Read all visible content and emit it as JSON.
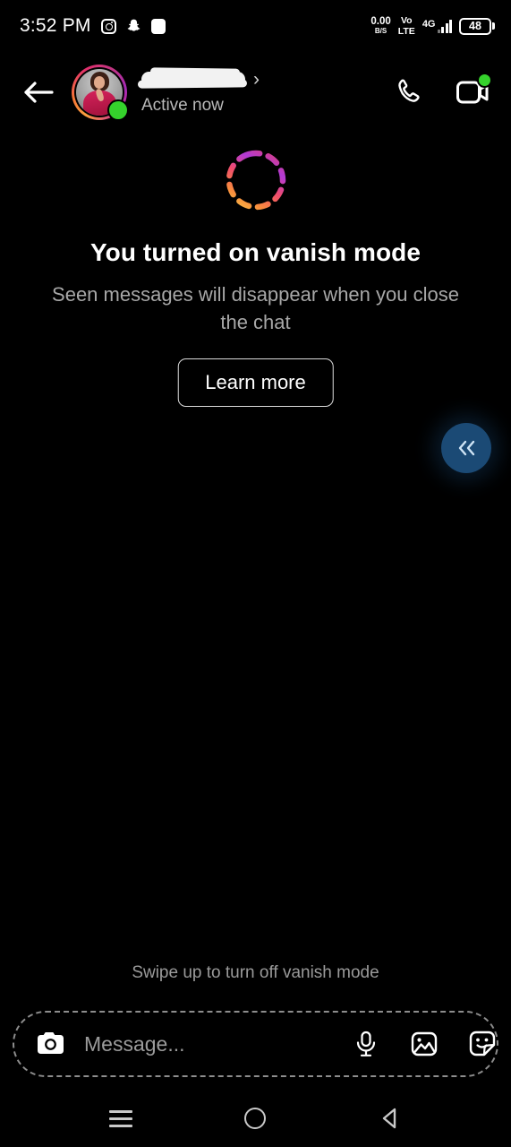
{
  "status_bar": {
    "time": "3:52 PM",
    "app_icons": [
      "instagram-icon",
      "snapchat-icon",
      "white-square-icon"
    ],
    "data_speed_value": "0.00",
    "data_speed_unit": "B/S",
    "volte_line1": "Vo",
    "volte_line2": "LTE",
    "network_type": "4G",
    "battery_percent": "48"
  },
  "header": {
    "back_icon": "arrow-left-icon",
    "username_redacted": "",
    "chevron": "›",
    "status": "Active now",
    "call_icon": "phone-icon",
    "video_icon": "video-camera-icon",
    "presence": "online"
  },
  "vanish": {
    "icon": "dashed-circle-icon",
    "title": "You turned on vanish mode",
    "subtitle": "Seen messages will disappear when you close the chat",
    "learn_more_label": "Learn more"
  },
  "floating_button": {
    "icon": "double-chevron-left-icon",
    "color": "#1b4a75"
  },
  "swipe_hint": "Swipe up to turn off vanish mode",
  "composer": {
    "camera_icon": "camera-icon",
    "placeholder": "Message...",
    "value": "",
    "mic_icon": "microphone-icon",
    "gallery_icon": "image-icon",
    "sticker_icon": "sticker-icon"
  },
  "nav_bar": {
    "recents_label": "recents-icon",
    "home_label": "home-circle-icon",
    "back_label": "back-triangle-icon"
  },
  "colors": {
    "background": "#000000",
    "accent_green": "#35d22c",
    "fab_blue": "#1b4a75",
    "muted_text": "#a7a7a7"
  }
}
